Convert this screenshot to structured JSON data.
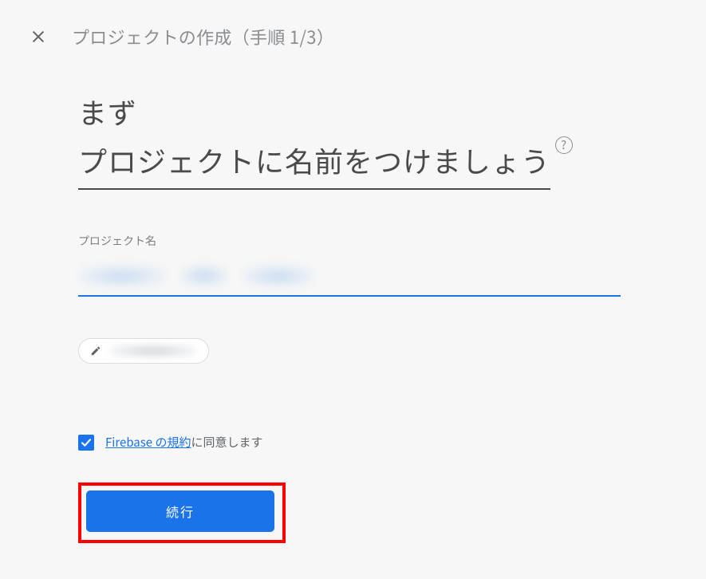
{
  "header": {
    "title": "プロジェクトの作成（手順 1/3）"
  },
  "main": {
    "heading_line1": "まず",
    "heading_line2": "プロジェクトに名前をつけましょう",
    "help_tooltip": "?"
  },
  "field": {
    "label": "プロジェクト名",
    "value": ""
  },
  "chip": {
    "icon": "pencil-icon",
    "value": ""
  },
  "terms": {
    "checked": true,
    "link_text": "Firebase の規約",
    "suffix_text": "に同意します"
  },
  "actions": {
    "continue_label": "続行"
  },
  "colors": {
    "accent": "#1a73e8",
    "highlight_box": "#ff0000"
  }
}
